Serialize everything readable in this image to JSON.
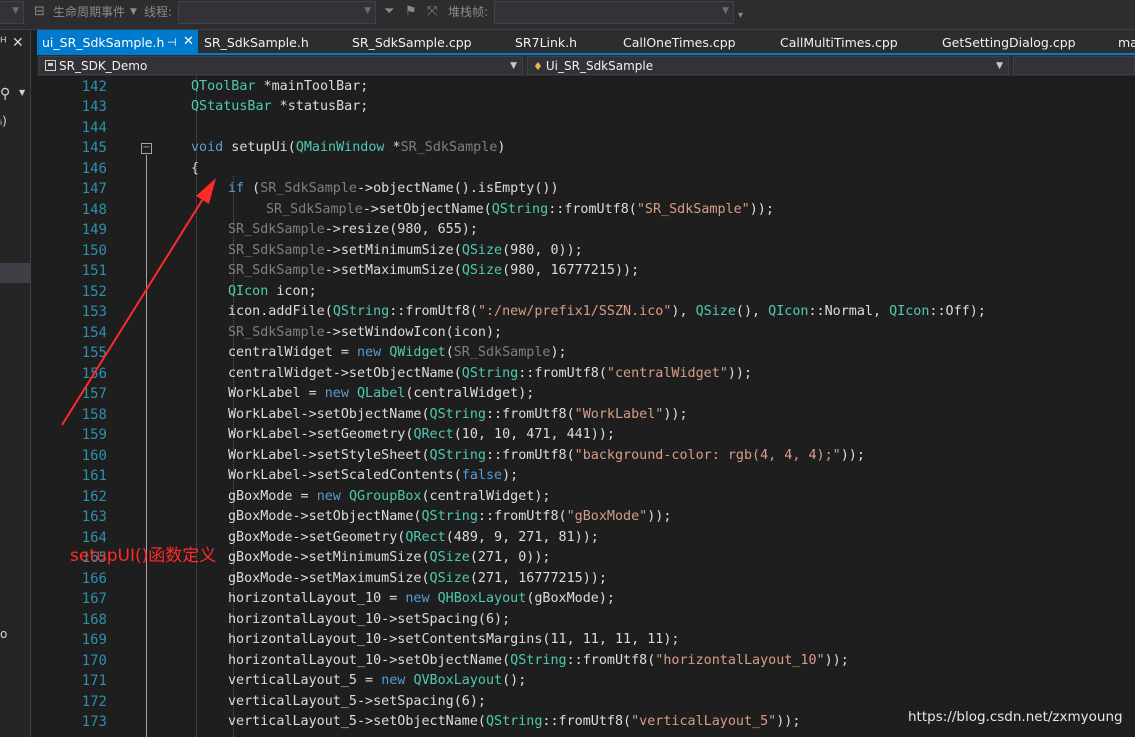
{
  "toolbar": {
    "lifecycle_label": "生命周期事件",
    "thread_label": "线程:",
    "stack_frame_label": "堆栈帧:"
  },
  "left_strip": {
    "items": [
      "ǳ",
      "ᵖ",
      "]",
      "⌐"
    ]
  },
  "tabs": [
    {
      "label": "ui_SR_SdkSample.h",
      "active": true
    },
    {
      "label": "SR_SdkSample.h"
    },
    {
      "label": "SR_SdkSample.cpp"
    },
    {
      "label": "SR7Link.h"
    },
    {
      "label": "CallOneTimes.cpp"
    },
    {
      "label": "CallMultiTimes.cpp"
    },
    {
      "label": "GetSettingDialog.cpp"
    },
    {
      "label": "ma"
    }
  ],
  "navbar": {
    "project": "SR_SDK_Demo",
    "scope": "Ui_SR_SdkSample"
  },
  "editor": {
    "lines": [
      {
        "n": "142",
        "indent": 1,
        "html": "<span class='ty'>QToolBar</span> *mainToolBar;"
      },
      {
        "n": "143",
        "indent": 1,
        "html": "<span class='ty'>QStatusBar</span> *statusBar;"
      },
      {
        "n": "144",
        "indent": 0,
        "html": ""
      },
      {
        "n": "145",
        "indent": 1,
        "html": "<span class='kw'>void</span> setupUi(<span class='ty'>QMainWindow</span> *<span class='pa'>SR_SdkSample</span>)"
      },
      {
        "n": "146",
        "indent": 1,
        "html": "{"
      },
      {
        "n": "147",
        "indent": 2,
        "html": "<span class='kw'>if</span> (<span class='pa'>SR_SdkSample</span>-&gt;objectName().isEmpty())"
      },
      {
        "n": "148",
        "indent": 3,
        "html": "<span class='pa'>SR_SdkSample</span>-&gt;setObjectName(<span class='ty'>QString</span>::fromUtf8(<span class='st'>\"SR_SdkSample\"</span>));"
      },
      {
        "n": "149",
        "indent": 2,
        "html": "<span class='pa'>SR_SdkSample</span>-&gt;resize(980, 655);"
      },
      {
        "n": "150",
        "indent": 2,
        "html": "<span class='pa'>SR_SdkSample</span>-&gt;setMinimumSize(<span class='ty'>QSize</span>(980, 0));"
      },
      {
        "n": "151",
        "indent": 2,
        "html": "<span class='pa'>SR_SdkSample</span>-&gt;setMaximumSize(<span class='ty'>QSize</span>(980, 16777215));"
      },
      {
        "n": "152",
        "indent": 2,
        "html": "<span class='ty'>QIcon</span> icon;"
      },
      {
        "n": "153",
        "indent": 2,
        "html": "icon.addFile(<span class='ty'>QString</span>::fromUtf8(<span class='st'>\":/new/prefix1/SSZN.ico\"</span>), <span class='ty'>QSize</span>(), <span class='ty'>QIcon</span>::Normal, <span class='ty'>QIcon</span>::Off);"
      },
      {
        "n": "154",
        "indent": 2,
        "html": "<span class='pa'>SR_SdkSample</span>-&gt;setWindowIcon(icon);"
      },
      {
        "n": "155",
        "indent": 2,
        "html": "centralWidget = <span class='kw'>new</span> <span class='ty'>QWidget</span>(<span class='pa'>SR_SdkSample</span>);"
      },
      {
        "n": "156",
        "indent": 2,
        "html": "centralWidget-&gt;setObjectName(<span class='ty'>QString</span>::fromUtf8(<span class='st'>\"centralWidget\"</span>));"
      },
      {
        "n": "157",
        "indent": 2,
        "html": "WorkLabel = <span class='kw'>new</span> <span class='ty'>QLabel</span>(centralWidget);"
      },
      {
        "n": "158",
        "indent": 2,
        "html": "WorkLabel-&gt;setObjectName(<span class='ty'>QString</span>::fromUtf8(<span class='st'>\"WorkLabel\"</span>));"
      },
      {
        "n": "159",
        "indent": 2,
        "html": "WorkLabel-&gt;setGeometry(<span class='ty'>QRect</span>(10, 10, 471, 441));"
      },
      {
        "n": "160",
        "indent": 2,
        "html": "WorkLabel-&gt;setStyleSheet(<span class='ty'>QString</span>::fromUtf8(<span class='st'>\"background-color: rgb(4, 4, 4);\"</span>));"
      },
      {
        "n": "161",
        "indent": 2,
        "html": "WorkLabel-&gt;setScaledContents(<span class='kw'>false</span>);"
      },
      {
        "n": "162",
        "indent": 2,
        "html": "gBoxMode = <span class='kw'>new</span> <span class='ty'>QGroupBox</span>(centralWidget);"
      },
      {
        "n": "163",
        "indent": 2,
        "html": "gBoxMode-&gt;setObjectName(<span class='ty'>QString</span>::fromUtf8(<span class='st'>\"gBoxMode\"</span>));"
      },
      {
        "n": "164",
        "indent": 2,
        "html": "gBoxMode-&gt;setGeometry(<span class='ty'>QRect</span>(489, 9, 271, 81));"
      },
      {
        "n": "165",
        "indent": 2,
        "html": "gBoxMode-&gt;setMinimumSize(<span class='ty'>QSize</span>(271, 0));"
      },
      {
        "n": "166",
        "indent": 2,
        "html": "gBoxMode-&gt;setMaximumSize(<span class='ty'>QSize</span>(271, 16777215));"
      },
      {
        "n": "167",
        "indent": 2,
        "html": "horizontalLayout_10 = <span class='kw'>new</span> <span class='ty'>QHBoxLayout</span>(gBoxMode);"
      },
      {
        "n": "168",
        "indent": 2,
        "html": "horizontalLayout_10-&gt;setSpacing(6);"
      },
      {
        "n": "169",
        "indent": 2,
        "html": "horizontalLayout_10-&gt;setContentsMargins(11, 11, 11, 11);"
      },
      {
        "n": "170",
        "indent": 2,
        "html": "horizontalLayout_10-&gt;setObjectName(<span class='ty'>QString</span>::fromUtf8(<span class='st'>\"horizontalLayout_10\"</span>));"
      },
      {
        "n": "171",
        "indent": 2,
        "html": "verticalLayout_5 = <span class='kw'>new</span> <span class='ty'>QVBoxLayout</span>();"
      },
      {
        "n": "172",
        "indent": 2,
        "html": "verticalLayout_5-&gt;setSpacing(6);"
      },
      {
        "n": "173",
        "indent": 2,
        "html": "verticalLayout_5-&gt;setObjectName(<span class='ty'>QString</span>::fromUtf8(<span class='st'>\"verticalLayout_5\"</span>));"
      }
    ]
  },
  "annotation": {
    "label": "setupUI()函数定义",
    "color": "#ff2a2a"
  },
  "watermark": "https://blog.csdn.net/zxmyoung",
  "colors": {
    "keyword": "#569cd6",
    "type": "#4ec9b0",
    "string": "#d69d85",
    "parameter": "#7f7f7f",
    "line_number": "#2b91af",
    "accent": "#007acc"
  }
}
